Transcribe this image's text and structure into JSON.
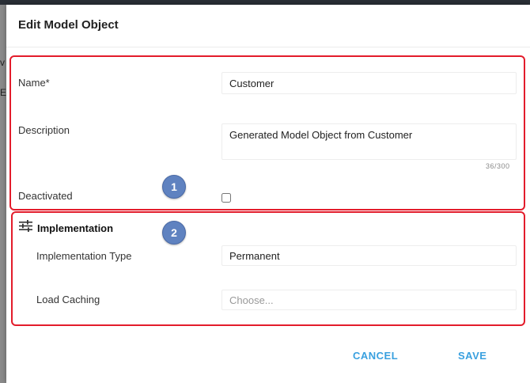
{
  "background": {
    "left_edge_glyphs": [
      "v",
      "E"
    ]
  },
  "dialog": {
    "title": "Edit Model Object"
  },
  "general": {
    "name": {
      "label": "Name*",
      "value": "Customer"
    },
    "description": {
      "label": "Description",
      "value": "Generated Model Object from Customer",
      "counter": "36/300"
    },
    "deactivated": {
      "label": "Deactivated",
      "checked": false
    }
  },
  "implementation": {
    "icon": "tune-sliders-icon",
    "title": "Implementation",
    "type": {
      "label": "Implementation Type",
      "value": "Permanent"
    },
    "caching": {
      "label": "Load Caching",
      "placeholder": "Choose..."
    }
  },
  "annotations": {
    "badge1": "1",
    "badge2": "2",
    "highlight_color": "#e31c2b",
    "badge_color": "#5f82c0"
  },
  "actions": {
    "cancel_label": "CANCEL",
    "save_label": "SAVE",
    "accent_color": "#39a0df"
  }
}
